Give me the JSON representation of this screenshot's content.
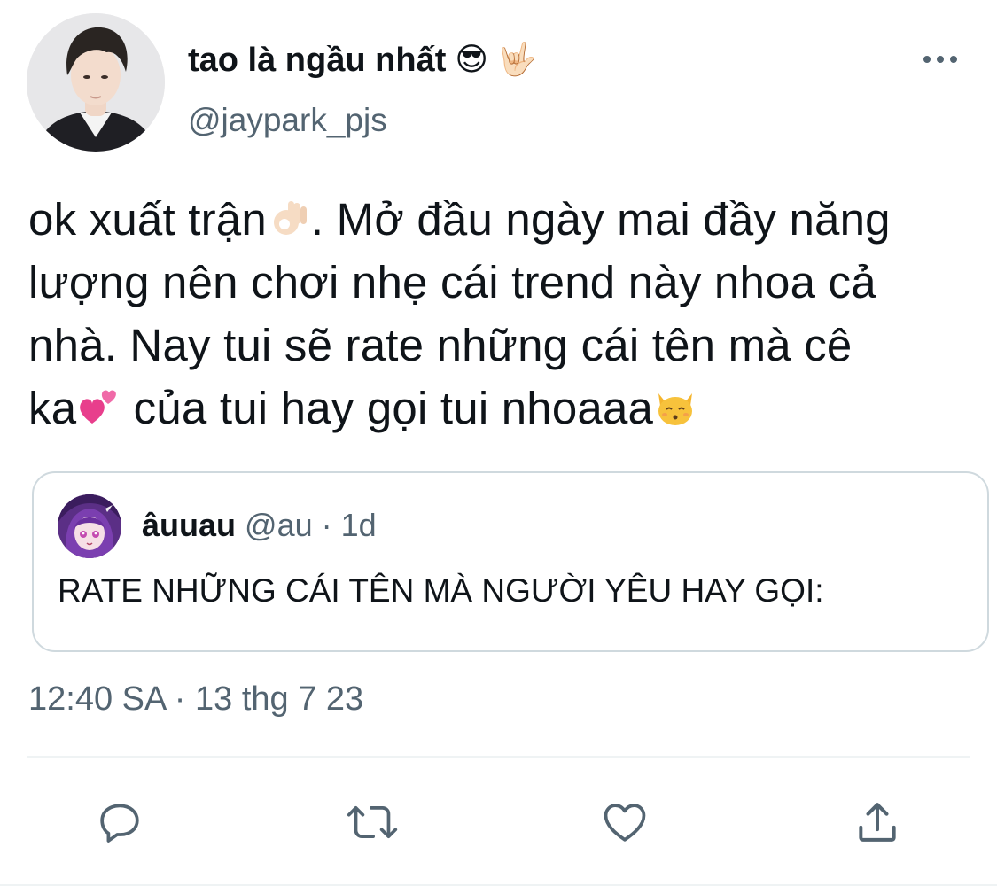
{
  "author": {
    "display_name": "tao là ngầu nhất",
    "name_emojis": [
      "😎",
      "🤟🏻"
    ],
    "handle": "@jaypark_pjs"
  },
  "tweet": {
    "lines": [
      "ok xuất trận",
      ". Mở đầu ngày mai đầy năng",
      "lượng nên chơi nhẹ cái trend này nhoa cả",
      "nhà. Nay tui sẽ rate những cái tên mà cê",
      "ka",
      " của tui hay gọi tui nhoaaa"
    ],
    "emojis": [
      "ok-hand-emoji",
      "two-hearts-emoji",
      "kissing-cat-emoji"
    ]
  },
  "quote": {
    "name": "âuuau",
    "meta": " @au · 1d",
    "text": "RATE NHỮNG CÁI TÊN MÀ NGƯỜI YÊU HAY GỌI:"
  },
  "timestamp": "12:40 SA · 13 thg 7 23",
  "actions": [
    "reply-icon",
    "retweet-icon",
    "like-icon",
    "share-icon"
  ],
  "colors": {
    "text": "#0f1419",
    "secondary": "#536471",
    "border": "#cfd9de",
    "icon": "#536471"
  }
}
